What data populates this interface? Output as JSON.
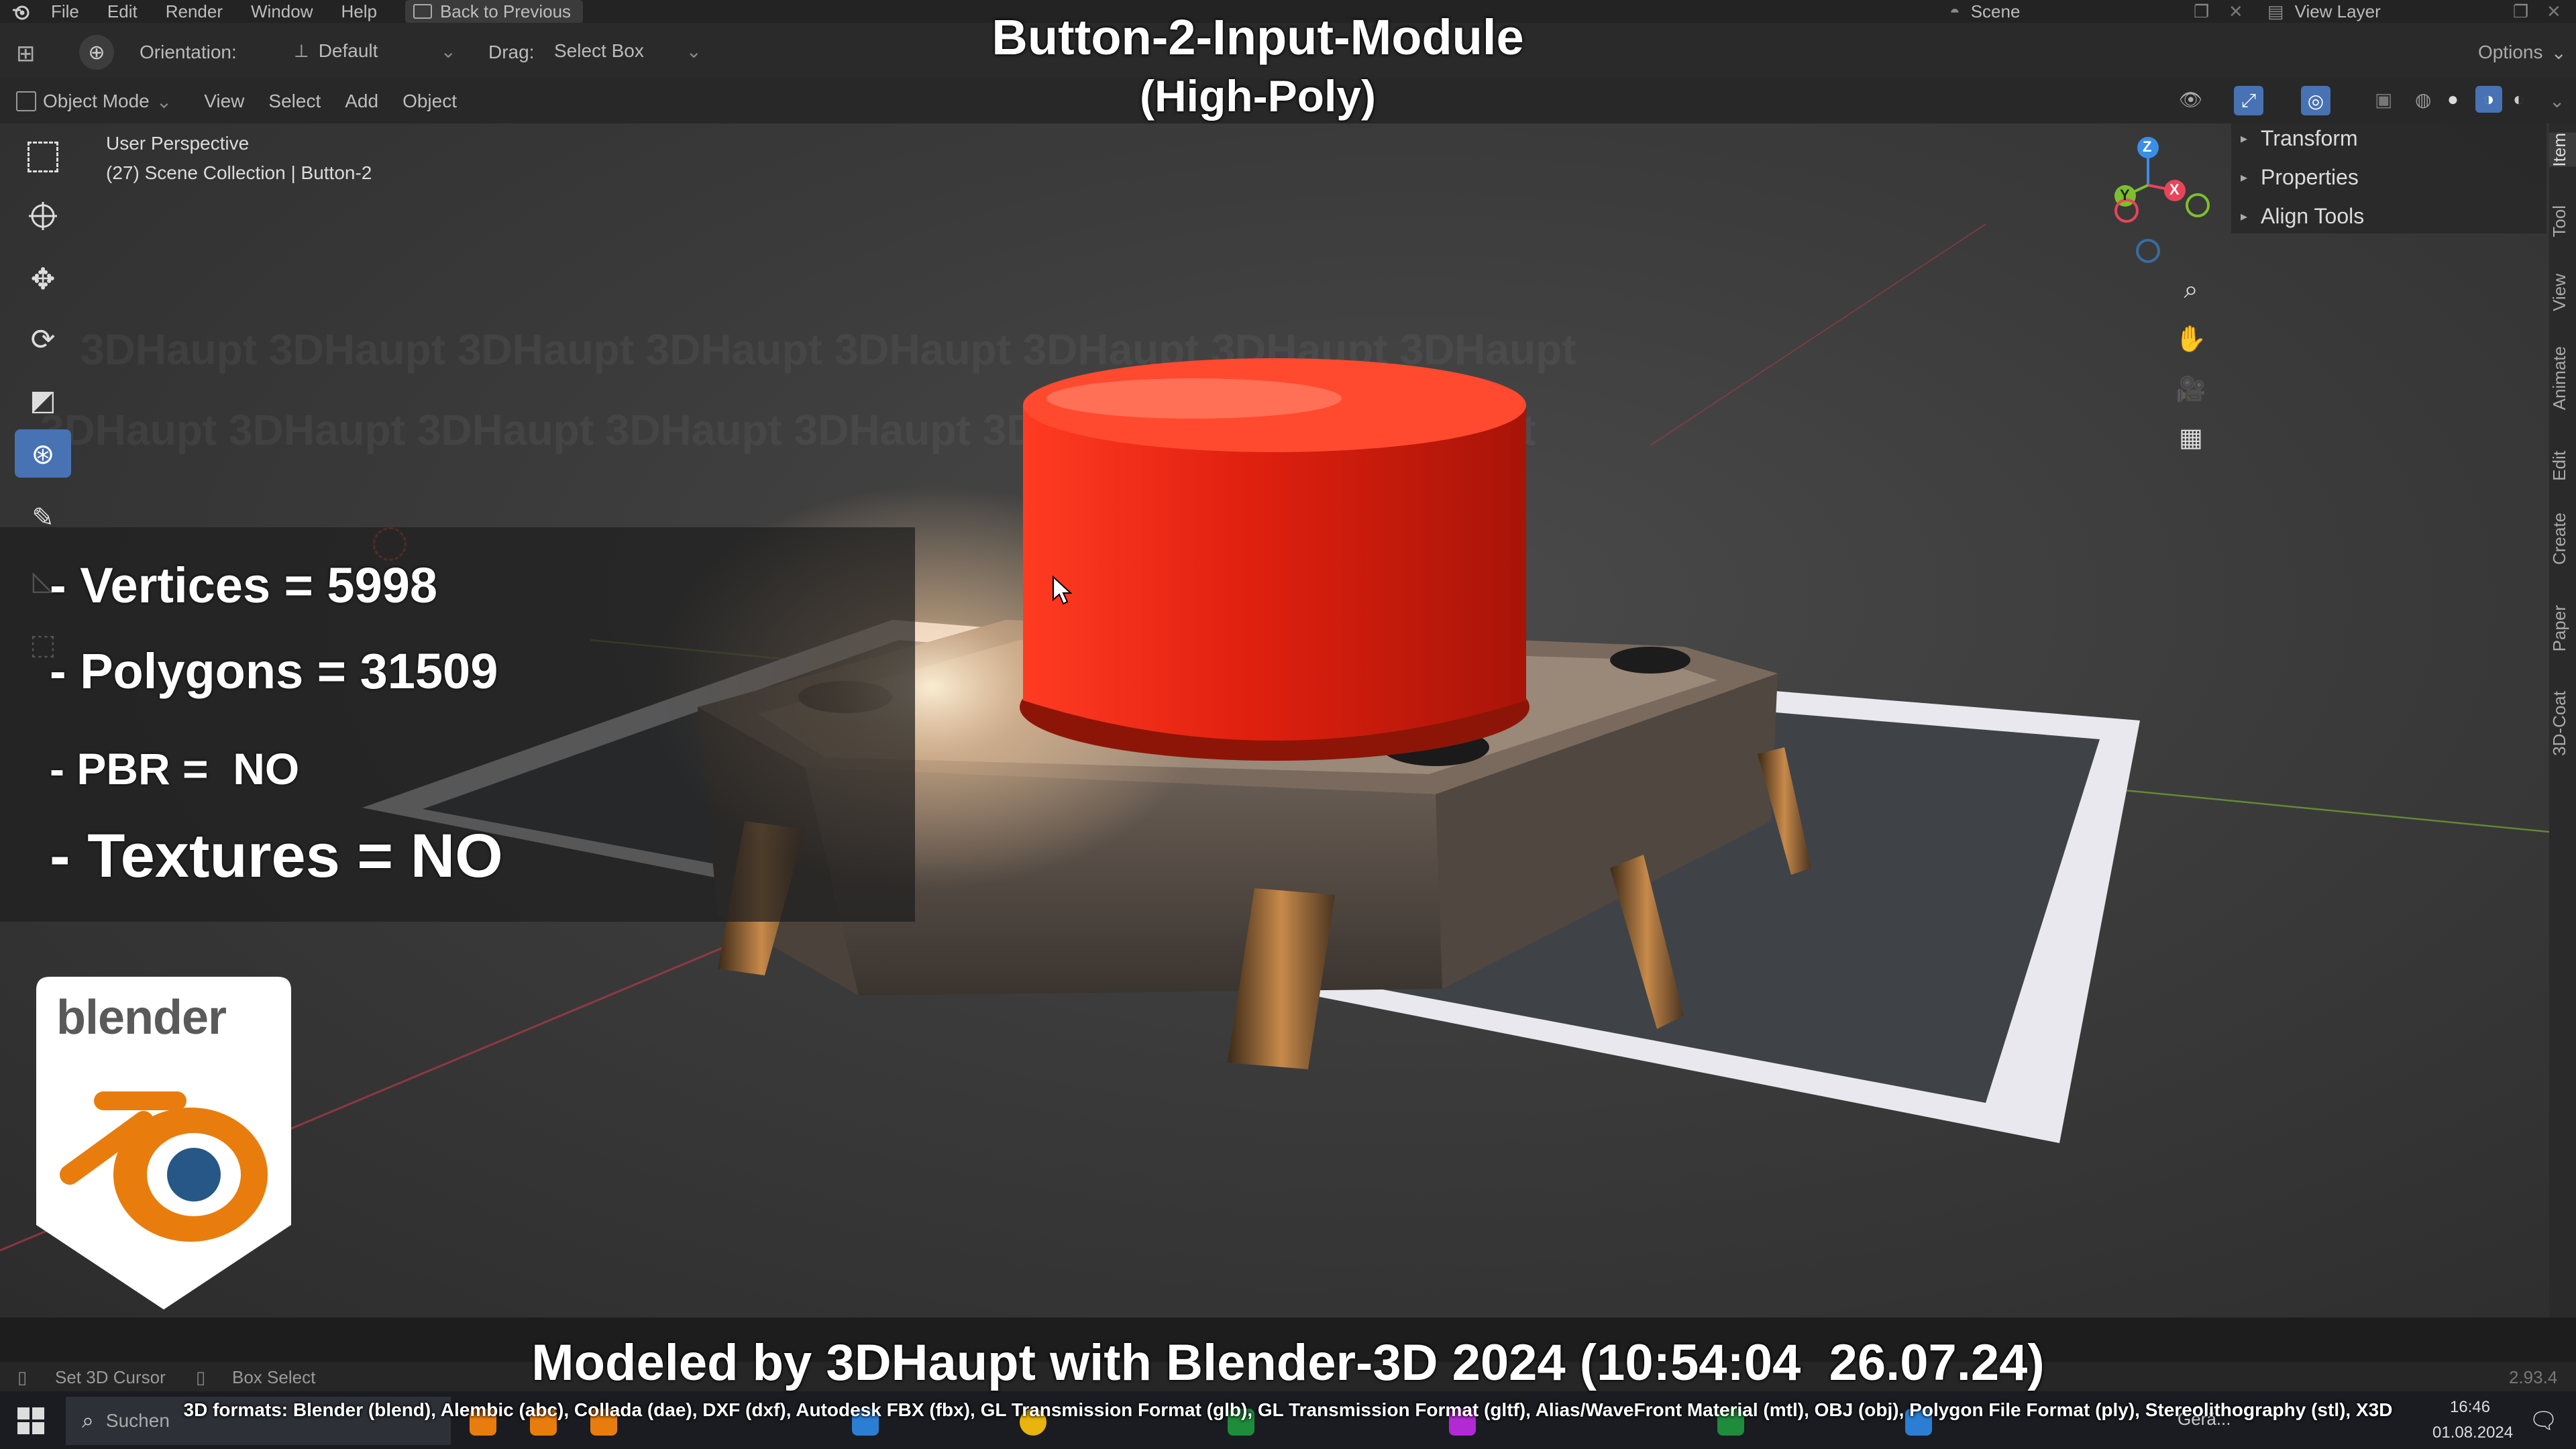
{
  "menu": {
    "items": [
      "File",
      "Edit",
      "Render",
      "Window",
      "Help"
    ],
    "back_label": "Back to Previous",
    "scene_label": "Scene",
    "view_layer_label": "View Layer"
  },
  "tool_header": {
    "orientation_label": "Orientation:",
    "orientation_value": "Default",
    "drag_label": "Drag:",
    "drag_value": "Select Box",
    "options_label": "Options"
  },
  "viewport_header": {
    "mode_label": "Object Mode",
    "menus": [
      "View",
      "Select",
      "Add",
      "Object"
    ]
  },
  "viewport_info": {
    "perspective": "User Perspective",
    "collection": "(27) Scene Collection | Button-2"
  },
  "npanel": {
    "items": [
      "Transform",
      "Properties",
      "Align Tools"
    ],
    "tabs": [
      "Item",
      "Tool",
      "View",
      "Animate",
      "Edit",
      "Create",
      "Paper",
      "3D-Coat"
    ]
  },
  "gizmo": {
    "x": "X",
    "y": "Y",
    "z": "Z"
  },
  "overlay": {
    "title_line1": "Button-2-Input-Module",
    "title_line2": "(High-Poly)",
    "stats": [
      "- Vertices = 5998",
      "- Polygons = 31509",
      "- PBR =  NO",
      "- Textures = NO"
    ],
    "logo_text": "blender",
    "modeled_by": "Modeled by 3DHaupt with Blender-3D 2024 (10:54:04  26.07.24)",
    "formats": "3D formats: Blender (blend), Alembic (abc), Collada (dae), DXF (dxf), Autodesk FBX (fbx), GL Transmission Format (glb), GL Transmission Format (gltf), Alias/WaveFront Material (mtl), OBJ (obj), Polygon File Format (ply), Stereolithography (stl), X3D"
  },
  "statusbar": {
    "set_cursor": "Set 3D Cursor",
    "box_select": "Box Select",
    "version": "2.93.4"
  },
  "taskbar": {
    "search_placeholder": "Suchen",
    "time": "16:46",
    "date": "01.08.2024",
    "app_label": "Gerä..."
  },
  "colors": {
    "accent_blue": "#4772b3",
    "button_red": "#e02818",
    "axis_x": "#e8455a",
    "axis_y": "#7dbf2f",
    "axis_z": "#3a8ee6",
    "blender_orange": "#e87d0d",
    "blender_blue": "#265787"
  }
}
